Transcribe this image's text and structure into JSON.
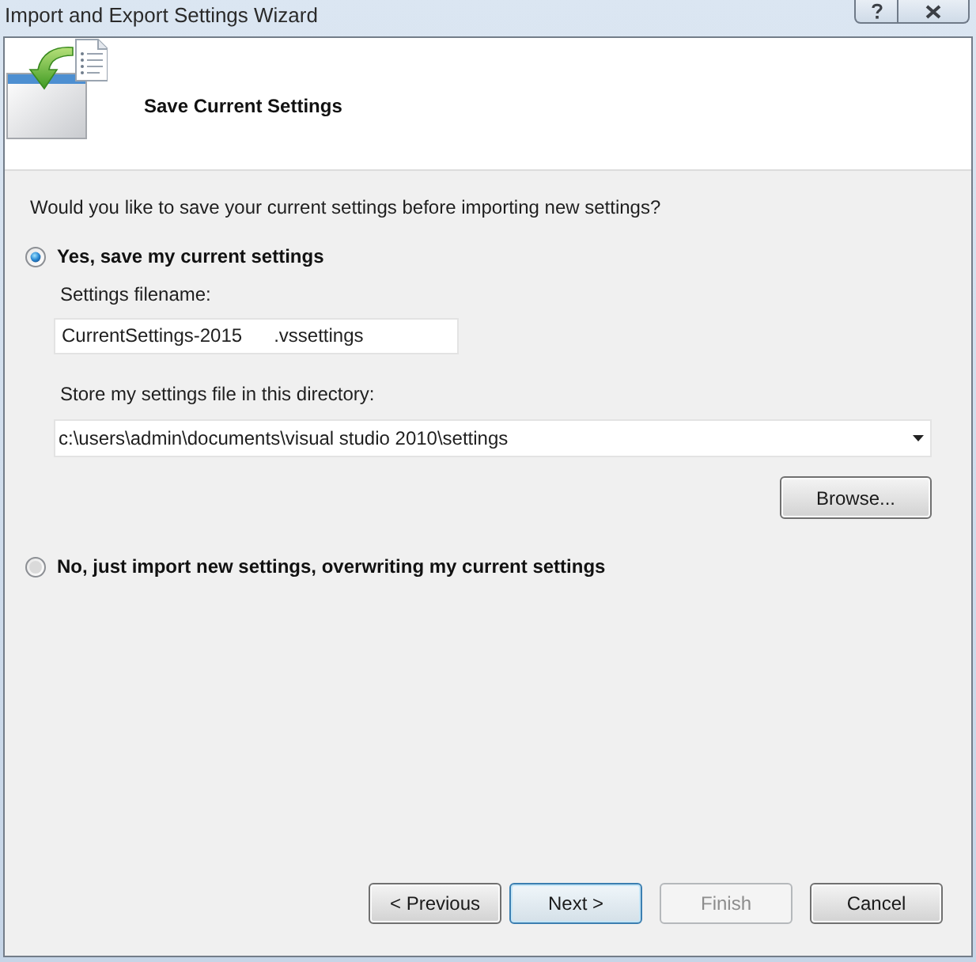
{
  "window": {
    "title": "Import and Export Settings Wizard"
  },
  "header": {
    "title": "Save Current Settings"
  },
  "prompt": "Would you like to save your current settings before importing new settings?",
  "options": [
    {
      "label": "Yes, save my current settings",
      "selected": true,
      "filename": {
        "label": "Settings filename:",
        "value": "CurrentSettings-2015      .vssettings"
      },
      "directory": {
        "label": "Store my settings file in this directory:",
        "value": "c:\\users\\admin\\documents\\visual studio 2010\\settings"
      },
      "browse_button": "Browse..."
    },
    {
      "label": "No, just import new settings, overwriting my current settings",
      "selected": false
    }
  ],
  "buttons": [
    {
      "label": "< Previous",
      "disabled": false,
      "focused": false
    },
    {
      "label": "Next >",
      "disabled": false,
      "focused": true
    },
    {
      "label": "Finish",
      "disabled": true,
      "focused": false
    },
    {
      "label": "Cancel",
      "disabled": false,
      "focused": false
    }
  ]
}
